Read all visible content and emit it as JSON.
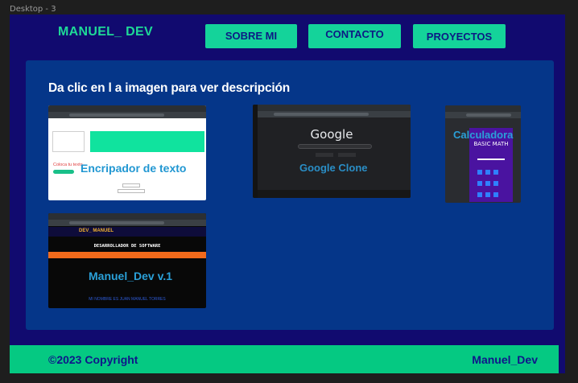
{
  "canvas": {
    "label": "Desktop - 3"
  },
  "header": {
    "brand": "MANUEL_ DEV",
    "nav": [
      {
        "label": "SOBRE MI"
      },
      {
        "label": "CONTACTO"
      },
      {
        "label": "PROYECTOS"
      }
    ]
  },
  "projects": {
    "title": "Da clic en l a imagen para ver descripción",
    "items": [
      {
        "caption": "Encripador de texto",
        "detail": "Coloca tu texto"
      },
      {
        "caption": "Google Clone",
        "detail": "Google"
      },
      {
        "caption": "Calculadora",
        "detail": "BASIC MATH"
      },
      {
        "caption": "Manuel_Dev v.1",
        "detail": "DESARROLLADOR DE SOFTWARE",
        "brand": "DEV_ MANUEL",
        "footer": "MI NOMBRE ES JUAN MANUEL TORRES"
      }
    ]
  },
  "footer": {
    "copyright": "©2023 Copyright",
    "name": "Manuel_Dev"
  },
  "colors": {
    "background": "#110a6f",
    "accent": "#14d39a",
    "panel": "#053689",
    "footer": "#05c982"
  }
}
